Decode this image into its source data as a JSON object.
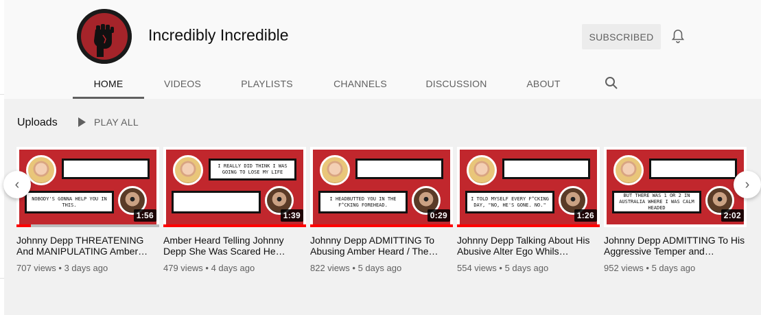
{
  "channel": {
    "name": "Incredibly Incredible",
    "subscribe_label": "SUBSCRIBED",
    "avatar_icon": "raised-fist-icon",
    "bell_icon": "bell-icon"
  },
  "tabs": [
    {
      "label": "HOME",
      "active": true
    },
    {
      "label": "VIDEOS",
      "active": false
    },
    {
      "label": "PLAYLISTS",
      "active": false
    },
    {
      "label": "CHANNELS",
      "active": false
    },
    {
      "label": "DISCUSSION",
      "active": false
    },
    {
      "label": "ABOUT",
      "active": false
    }
  ],
  "search_icon": "search-icon",
  "uploads": {
    "title": "Uploads",
    "play_all_label": "PLAY ALL",
    "prev_label": "‹",
    "next_label": "›",
    "videos": [
      {
        "title": "Johnny Depp THREATENING And MANIPULATING Amber…",
        "views": "707 views",
        "age": "3 days ago",
        "duration": "1:56",
        "progress": 0.1,
        "bubble_top": "",
        "bubble_bottom": "NOBODY'S GONNA HELP YOU IN THIS."
      },
      {
        "title": "Amber Heard Telling Johnny Depp She Was Scared He…",
        "views": "479 views",
        "age": "4 days ago",
        "duration": "1:39",
        "progress": 1.0,
        "bubble_top": "I REALLY DID THINK I WAS GOING TO LOSE MY LIFE",
        "bubble_bottom": ""
      },
      {
        "title": "Johnny Depp ADMITTING To Abusing Amber Heard / The…",
        "views": "822 views",
        "age": "5 days ago",
        "duration": "0:29",
        "progress": 1.0,
        "bubble_top": "",
        "bubble_bottom": "I HEADBUTTED YOU IN THE F^CKING FOREHEAD."
      },
      {
        "title": "Johnny Depp Talking About His Abusive Alter Ego Whils…",
        "views": "554 views",
        "age": "5 days ago",
        "duration": "1:26",
        "progress": 1.0,
        "bubble_top": "",
        "bubble_bottom": "I TOLD MYSELF EVERY F^CKING DAY, \"NO, HE'S GONE. NO.\""
      },
      {
        "title": "Johnny Depp ADMITTING To His Aggressive Temper and…",
        "views": "952 views",
        "age": "5 days ago",
        "duration": "2:02",
        "progress": 0,
        "bubble_top": "",
        "bubble_bottom": "BUT THERE WAS 1 OR 2 IN AUSTRALIA WHERE I WAS CALM HEADED"
      }
    ]
  },
  "colors": {
    "thumbnail_red": "#c1272d",
    "progress_red": "#ff0000"
  }
}
